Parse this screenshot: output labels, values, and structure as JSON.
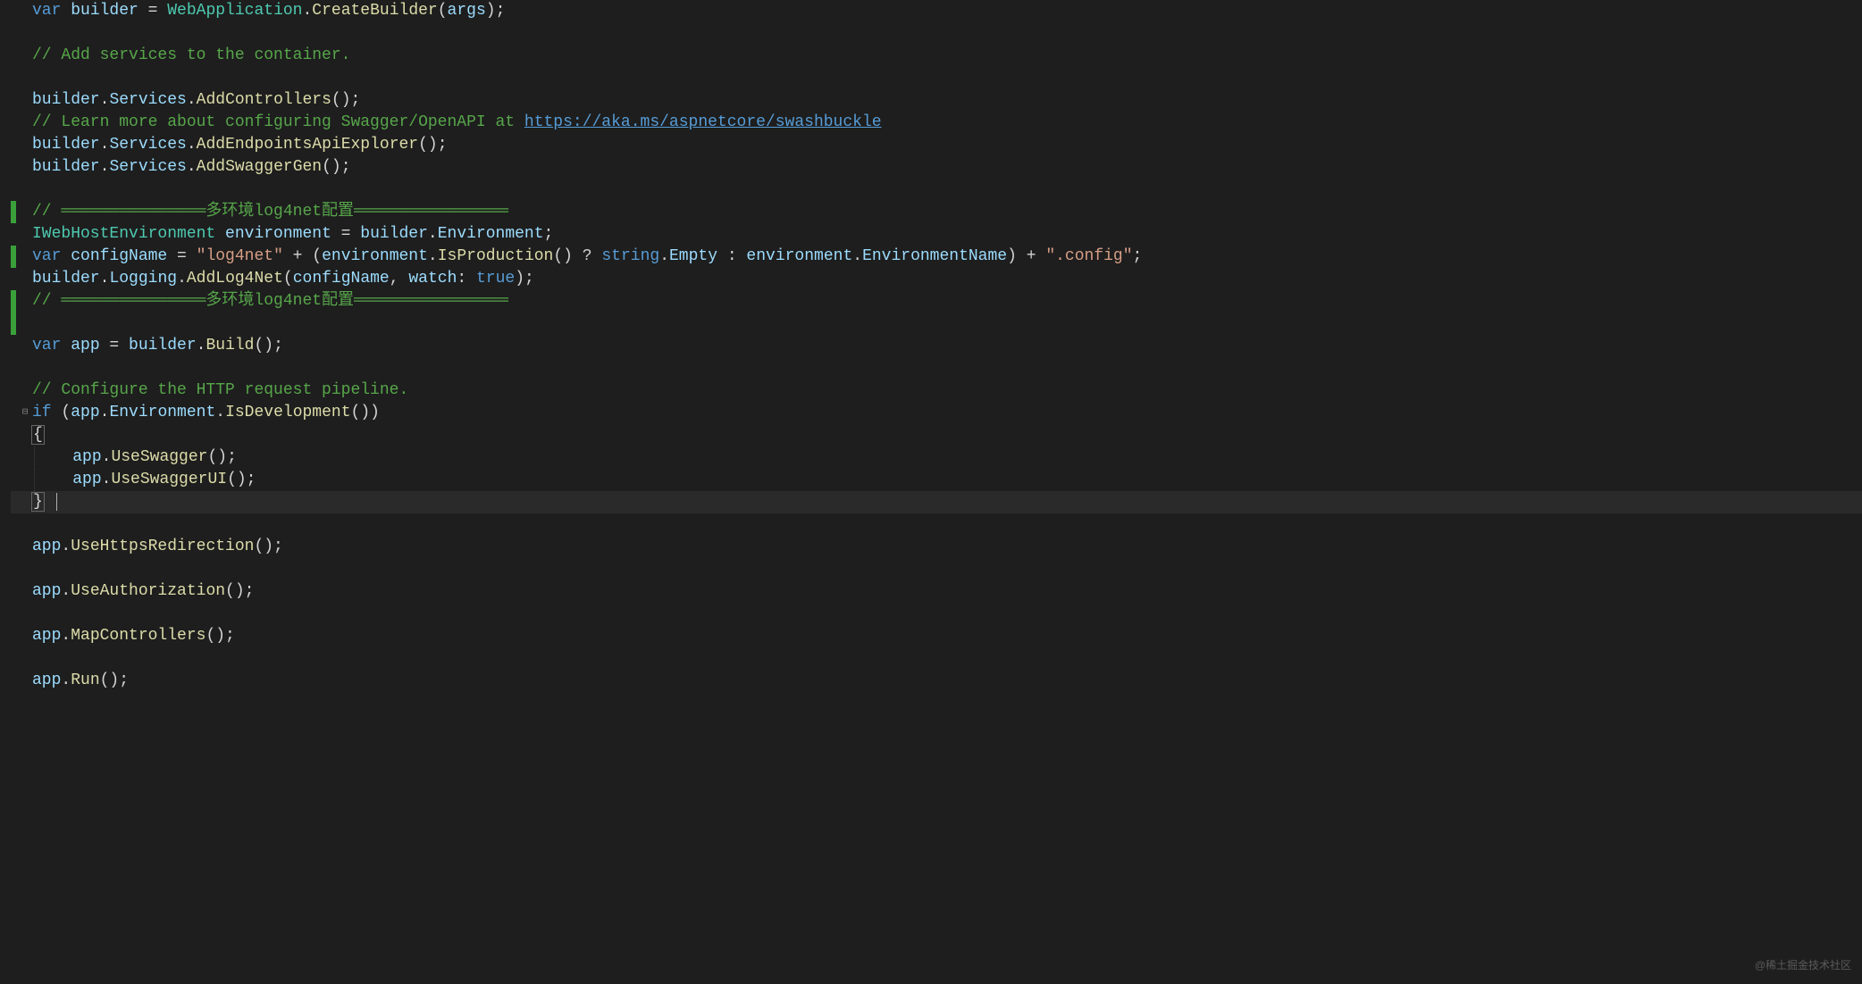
{
  "watermark": "@稀土掘金技术社区",
  "tokens": {
    "var": "var",
    "if": "if",
    "true": "true",
    "builder": "builder",
    "args": "args",
    "environment": "environment",
    "configName": "configName",
    "app": "app",
    "watch": "watch",
    "string": "string",
    "WebApplication": "WebApplication",
    "IWebHostEnvironment": "IWebHostEnvironment",
    "Services": "Services",
    "Logging": "Logging",
    "Environment": "Environment",
    "EnvironmentName": "EnvironmentName",
    "Empty": "Empty",
    "CreateBuilder": "CreateBuilder",
    "AddControllers": "AddControllers",
    "AddEndpointsApiExplorer": "AddEndpointsApiExplorer",
    "AddSwaggerGen": "AddSwaggerGen",
    "AddLog4Net": "AddLog4Net",
    "IsProduction": "IsProduction",
    "IsDevelopment": "IsDevelopment",
    "Build": "Build",
    "UseSwagger": "UseSwagger",
    "UseSwaggerUI": "UseSwaggerUI",
    "UseHttpsRedirection": "UseHttpsRedirection",
    "UseAuthorization": "UseAuthorization",
    "MapControllers": "MapControllers",
    "Run": "Run"
  },
  "strings": {
    "log4net": "\"log4net\"",
    "config": "\".config\""
  },
  "comments": {
    "add_services": "// Add services to the container.",
    "learn_more": "// Learn more about configuring Swagger/OpenAPI at ",
    "swagger_url": "https://aka.ms/swashbuckle",
    "swagger_url_display": "https://aka.ms/aspnetcore/swashbuckle",
    "log4net_header": "// ═══════════════多环境log4net配置════════════════",
    "configure_pipeline": "// Configure the HTTP request pipeline."
  },
  "fold": {
    "minus": "⊟"
  }
}
